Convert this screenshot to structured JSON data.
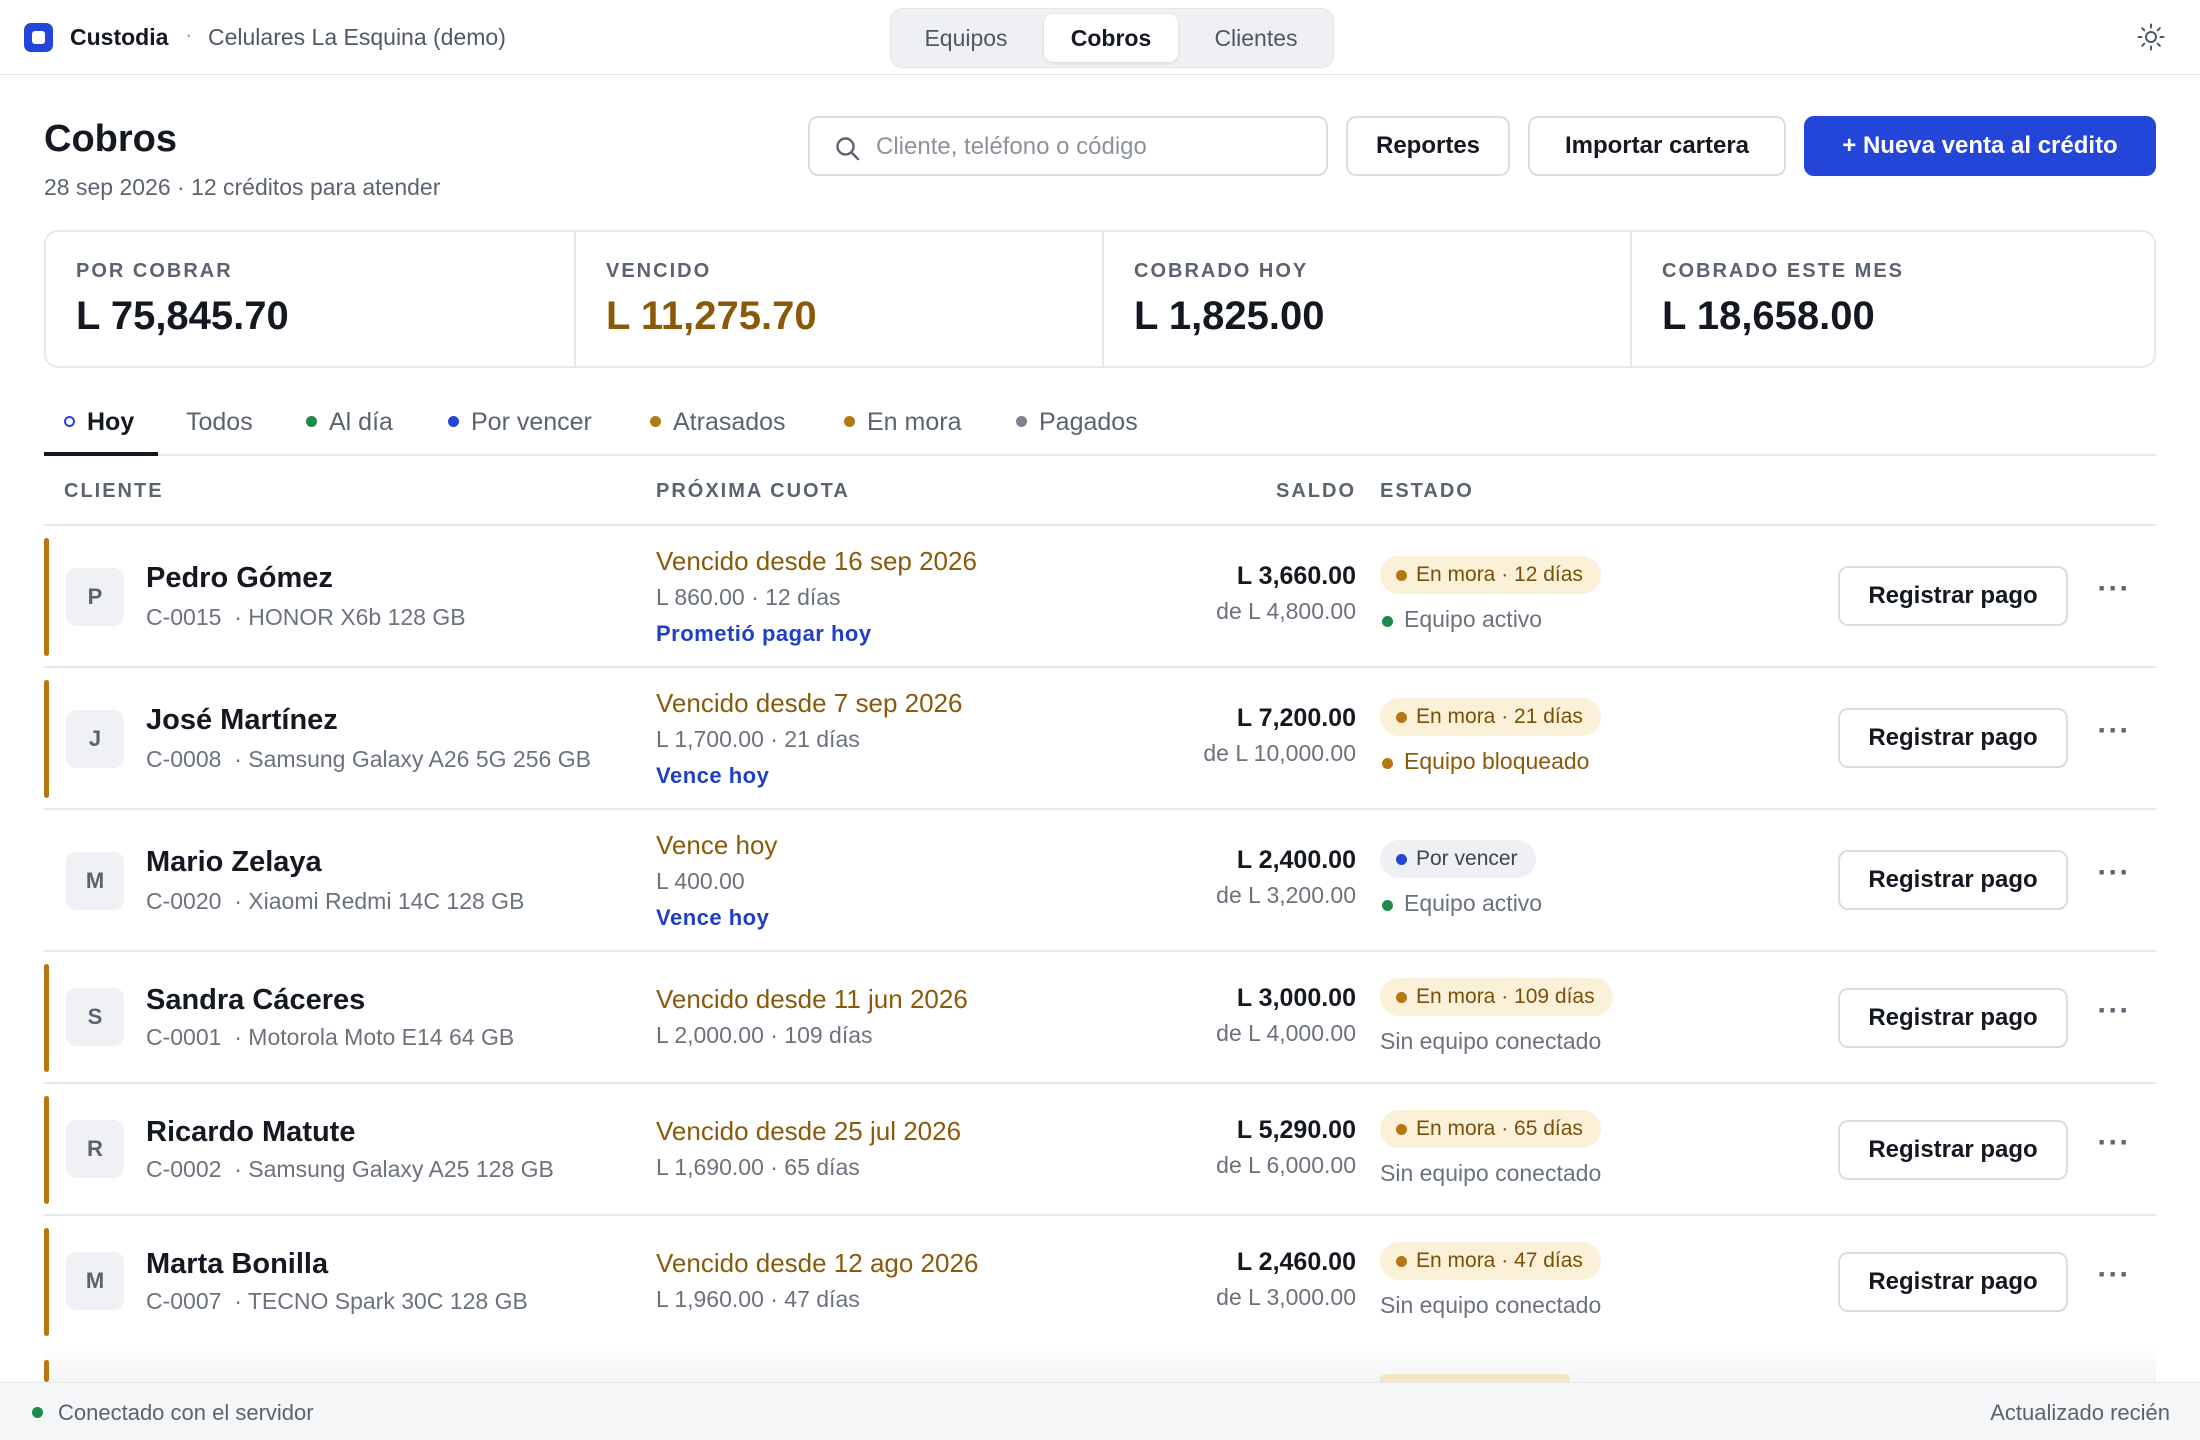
{
  "topbar": {
    "brand": "Custodia",
    "separator": "·",
    "store": "Celulares La Esquina (demo)",
    "nav": [
      {
        "label": "Equipos",
        "active": false
      },
      {
        "label": "Cobros",
        "active": true
      },
      {
        "label": "Clientes",
        "active": false
      }
    ],
    "theme_icon": "sun-icon"
  },
  "header": {
    "title": "Cobros",
    "subtitle": "28 sep 2026 · 12 créditos para atender",
    "search_placeholder": "Cliente, teléfono o código",
    "reports_label": "Reportes",
    "import_label": "Importar cartera",
    "new_sale_label": "+  Nueva venta al crédito"
  },
  "kpis": [
    {
      "label": "POR COBRAR",
      "value": "L 75,845.70"
    },
    {
      "label": "VENCIDO",
      "value": "L 11,275.70"
    },
    {
      "label": "COBRADO HOY",
      "value": "L 1,825.00"
    },
    {
      "label": "COBRADO ESTE MES",
      "value": "L 18,658.00"
    }
  ],
  "tabs": [
    {
      "label": "Hoy",
      "active": true
    },
    {
      "label": "Todos"
    },
    {
      "label": "Al día",
      "color": "#1e8a4c"
    },
    {
      "label": "Por vencer",
      "color": "#2446d8"
    },
    {
      "label": "Atrasados",
      "color": "#b5780f"
    },
    {
      "label": "En mora",
      "color": "#b5780f"
    },
    {
      "label": "Pagados",
      "color": "#7c838e"
    }
  ],
  "table": {
    "headers": {
      "client": "CLIENTE",
      "next": "PRÓXIMA CUOTA",
      "balance": "SALDO",
      "status": "ESTADO"
    },
    "action_label": "Registrar pago",
    "more_icon": "more-icon",
    "rows": [
      {
        "initial": "P",
        "name": "Pedro Gómez",
        "code": "C-0015",
        "device": "HONOR X6b 128 GB",
        "due": "Vencido desde 16 sep 2026",
        "due_sub": "L 860.00 · 12 días",
        "note": "Prometió pagar hoy",
        "balance": "L 3,660.00",
        "of": "de L 4,800.00",
        "status": "En mora · 12 días",
        "status_kind": "mora",
        "device_state": "Equipo activo",
        "device_kind": "ok"
      },
      {
        "initial": "J",
        "name": "José Martínez",
        "code": "C-0008",
        "device": "Samsung Galaxy A26 5G 256 GB",
        "due": "Vencido desde 7 sep 2026",
        "due_sub": "L 1,700.00 · 21 días",
        "note": "Vence hoy",
        "balance": "L 7,200.00",
        "of": "de L 10,000.00",
        "status": "En mora · 21 días",
        "status_kind": "mora",
        "device_state": "Equipo bloqueado",
        "device_kind": "lock"
      },
      {
        "initial": "M",
        "name": "Mario Zelaya",
        "code": "C-0020",
        "device": "Xiaomi Redmi 14C 128 GB",
        "due": "Vence hoy",
        "due_sub": "L 400.00",
        "note": "Vence hoy",
        "balance": "L 2,400.00",
        "of": "de L 3,200.00",
        "status": "Por vencer",
        "status_kind": "vencer",
        "device_state": "Equipo activo",
        "device_kind": "ok"
      },
      {
        "initial": "S",
        "name": "Sandra Cáceres",
        "code": "C-0001",
        "device": "Motorola Moto E14 64 GB",
        "due": "Vencido desde 11 jun 2026",
        "due_sub": "L 2,000.00 · 109 días",
        "note": "",
        "balance": "L 3,000.00",
        "of": "de L 4,000.00",
        "status": "En mora · 109 días",
        "status_kind": "mora",
        "device_state": "Sin equipo conectado",
        "device_kind": "none"
      },
      {
        "initial": "R",
        "name": "Ricardo Matute",
        "code": "C-0002",
        "device": "Samsung Galaxy A25 128 GB",
        "due": "Vencido desde 25 jul 2026",
        "due_sub": "L 1,690.00 · 65 días",
        "note": "",
        "balance": "L 5,290.00",
        "of": "de L 6,000.00",
        "status": "En mora · 65 días",
        "status_kind": "mora",
        "device_state": "Sin equipo conectado",
        "device_kind": "none"
      },
      {
        "initial": "M",
        "name": "Marta Bonilla",
        "code": "C-0007",
        "device": "TECNO Spark 30C 128 GB",
        "due": "Vencido desde 12 ago 2026",
        "due_sub": "L 1,960.00 · 47 días",
        "note": "",
        "balance": "L 2,460.00",
        "of": "de L 3,000.00",
        "status": "En mora · 47 días",
        "status_kind": "mora",
        "device_state": "Sin equipo conectado",
        "device_kind": "none"
      }
    ]
  },
  "statusbar": {
    "connection": "Conectado con el servidor",
    "updated": "Actualizado recién"
  }
}
